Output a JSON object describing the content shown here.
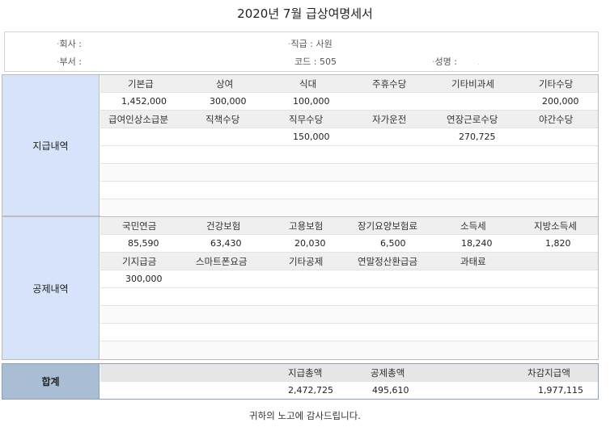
{
  "title": "2020년 7월 급상여명세서",
  "info": {
    "company_label": "회사",
    "company_value": "",
    "position_label": "직급",
    "position_value": "사원",
    "dept_label": "부서",
    "dept_value": "",
    "code_label": "코드",
    "code_value": "505",
    "name_label": "성명",
    "name_value": "",
    "bullet": "·",
    "separator": ":",
    "tiny_mark": "."
  },
  "payment": {
    "label": "지급내역",
    "headers1": [
      "기본급",
      "상여",
      "식대",
      "주휴수당",
      "기타비과세",
      "기타수당"
    ],
    "values1": [
      "1,452,000",
      "300,000",
      "100,000",
      "",
      "",
      "200,000"
    ],
    "headers2": [
      "급여인상소급분",
      "직책수당",
      "직무수당",
      "자가운전",
      "연장근로수당",
      "야간수당"
    ],
    "values2": [
      "",
      "",
      "150,000",
      "",
      "270,725",
      ""
    ]
  },
  "deduction": {
    "label": "공제내역",
    "headers1": [
      "국민연금",
      "건강보험",
      "고용보험",
      "장기요양보험료",
      "소득세",
      "지방소득세"
    ],
    "values1": [
      "85,590",
      "63,430",
      "20,030",
      "6,500",
      "18,240",
      "1,820"
    ],
    "headers2": [
      "기지급금",
      "스마트폰요금",
      "기타공제",
      "연말정산환급금",
      "과태료",
      ""
    ],
    "values2": [
      "300,000",
      "",
      "",
      "",
      "",
      ""
    ]
  },
  "total": {
    "label": "합계",
    "headers": [
      "",
      "",
      "지급총액",
      "공제총액",
      "",
      "차감지급액"
    ],
    "values": [
      "",
      "",
      "2,472,725",
      "495,610",
      "",
      "1,977,115"
    ]
  },
  "footer": "귀하의 노고에 감사드립니다."
}
